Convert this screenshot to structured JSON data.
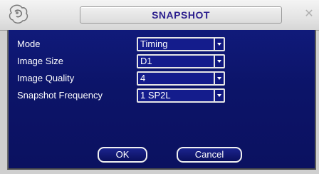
{
  "window": {
    "title": "SNAPSHOT",
    "close_glyph": "✕",
    "logo_icon": "app-logo-icon"
  },
  "form": {
    "mode": {
      "label": "Mode",
      "value": "Timing"
    },
    "image_size": {
      "label": "Image Size",
      "value": "D1"
    },
    "image_quality": {
      "label": "Image Quality",
      "value": "4"
    },
    "snapshot_frequency": {
      "label": "Snapshot Frequency",
      "value": "1 SP2L"
    }
  },
  "buttons": {
    "ok": "OK",
    "cancel": "Cancel"
  },
  "colors": {
    "panel": "#0c1469",
    "title_text": "#2c1f8e",
    "field_border": "#e6e6e6"
  }
}
